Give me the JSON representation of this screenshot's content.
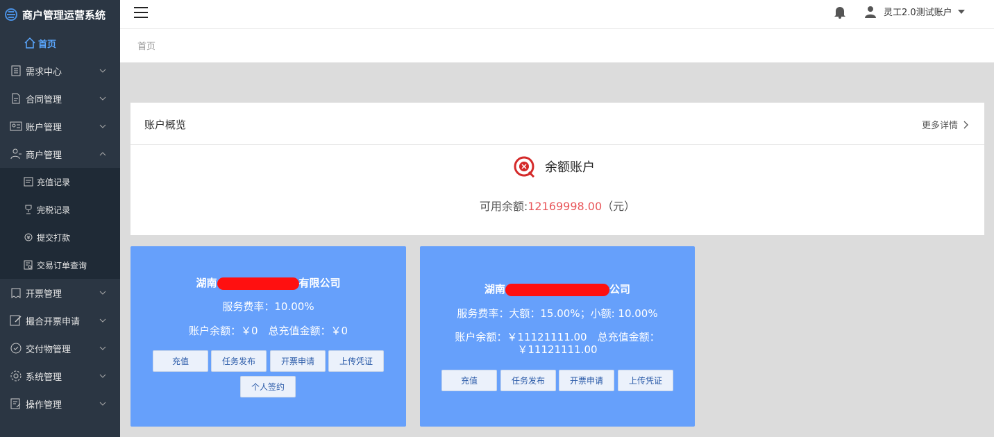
{
  "app": {
    "title": "商户管理运营系统"
  },
  "sidebar": {
    "home": "首页",
    "items": [
      {
        "label": "需求中心",
        "icon": "list-icon"
      },
      {
        "label": "合同管理",
        "icon": "document-icon"
      },
      {
        "label": "账户管理",
        "icon": "id-card-icon"
      },
      {
        "label": "商户管理",
        "icon": "user-group-icon"
      }
    ],
    "submenu": [
      {
        "label": "充值记录",
        "icon": "record-icon"
      },
      {
        "label": "完税记录",
        "icon": "trophy-icon"
      },
      {
        "label": "提交打款",
        "icon": "payment-icon"
      },
      {
        "label": "交易订单查询",
        "icon": "order-icon"
      }
    ],
    "items_after": [
      {
        "label": "开票管理",
        "icon": "invoice-icon"
      },
      {
        "label": "撮合开票申请",
        "icon": "edit-icon"
      },
      {
        "label": "交付物管理",
        "icon": "delivery-icon"
      },
      {
        "label": "系统管理",
        "icon": "gear-icon"
      },
      {
        "label": "操作管理",
        "icon": "operation-icon"
      }
    ]
  },
  "header": {
    "user_name": "灵工2.0测试账户"
  },
  "breadcrumb": {
    "current": "首页"
  },
  "overview": {
    "title": "账户概览",
    "more_link": "更多详情",
    "balance_title": "余额账户",
    "balance_label": "可用余额:",
    "balance_amount": "12169998.00",
    "balance_unit": "（元）"
  },
  "cards": [
    {
      "name_prefix": "湖南",
      "name_suffix": "有限公司",
      "fee_rate": "服务费率：10.00%",
      "balance_line": "账户余额：￥0　总充值金额：￥0",
      "buttons": [
        "充值",
        "任务发布",
        "开票申请",
        "上传凭证",
        "个人签约"
      ]
    },
    {
      "name_prefix": "湖南",
      "name_suffix": "公司",
      "fee_rate": "服务费率：大额：15.00%；小额: 10.00%",
      "balance_line1": "账户余额：￥11121111.00　总充值金额：",
      "balance_line2": "￥11121111.00",
      "buttons": [
        "充值",
        "任务发布",
        "开票申请",
        "上传凭证"
      ]
    }
  ],
  "colors": {
    "sidebar_bg": "#2b3643",
    "submenu_bg": "#1f2a36",
    "accent": "#5aa7ff",
    "card_bg": "#66a0fb",
    "amount_red": "#e8565a",
    "redaction": "#ff1010"
  }
}
